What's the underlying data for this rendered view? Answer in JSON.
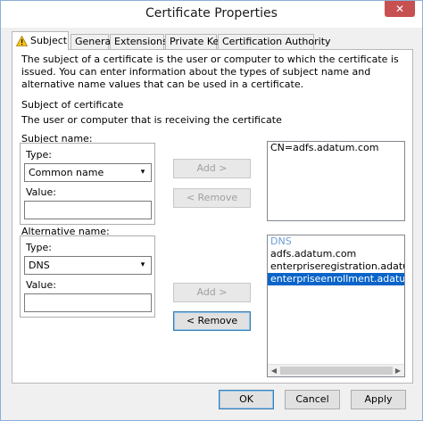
{
  "window": {
    "title": "Certificate Properties",
    "close_label": "✕"
  },
  "tabs": [
    {
      "label": "Subject"
    },
    {
      "label": "General"
    },
    {
      "label": "Extensions"
    },
    {
      "label": "Private Key"
    },
    {
      "label": "Certification Authority"
    }
  ],
  "subject_tab": {
    "description": "The subject of a certificate is the user or computer to which the certificate is issued. You can enter information about the types of subject name and alternative name values that can be used in a certificate.",
    "section_title": "Subject of certificate",
    "section_desc": "The user or computer that is receiving the certificate",
    "subject_name": {
      "group_label": "Subject name:",
      "type_label": "Type:",
      "type_value": "Common name",
      "value_label": "Value:",
      "value": "",
      "entries": [
        "CN=adfs.adatum.com"
      ]
    },
    "alternative_name": {
      "group_label": "Alternative name:",
      "type_label": "Type:",
      "type_value": "DNS",
      "value_label": "Value:",
      "value": "",
      "list_header": "DNS",
      "entries": [
        "adfs.adatum.com",
        "enterpriseregistration.adatum.c",
        "enterpriseenrollment.adatum.c"
      ],
      "selected_index": 2
    },
    "add_label": "Add >",
    "remove_label": "< Remove"
  },
  "footer": {
    "ok_label": "OK",
    "cancel_label": "Cancel",
    "apply_label": "Apply"
  }
}
